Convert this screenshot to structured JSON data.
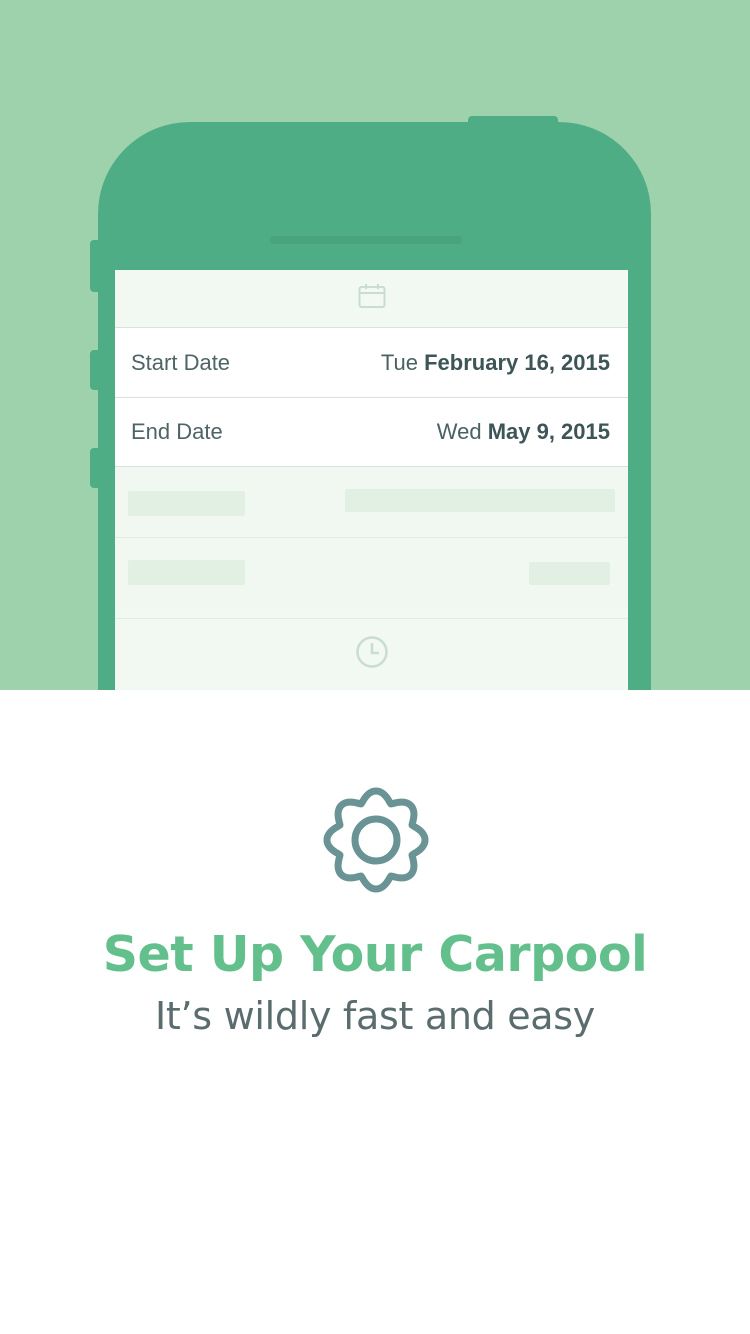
{
  "colors": {
    "hero_background": "#9dd2ad",
    "phone_body": "#4fad85",
    "title": "#63c08c",
    "subtitle": "#5a6c6e",
    "gear": "#6a9395"
  },
  "icons": {
    "top": "calendar-icon",
    "bottom": "clock-icon",
    "feature": "gear-icon"
  },
  "form": {
    "start": {
      "label": "Start Date",
      "weekday": "Tue",
      "date": "February 16, 2015"
    },
    "end": {
      "label": "End Date",
      "weekday": "Wed",
      "date": "May 9, 2015"
    }
  },
  "onboarding": {
    "title": "Set Up Your Carpool",
    "subtitle": "It’s wildly fast and easy"
  }
}
